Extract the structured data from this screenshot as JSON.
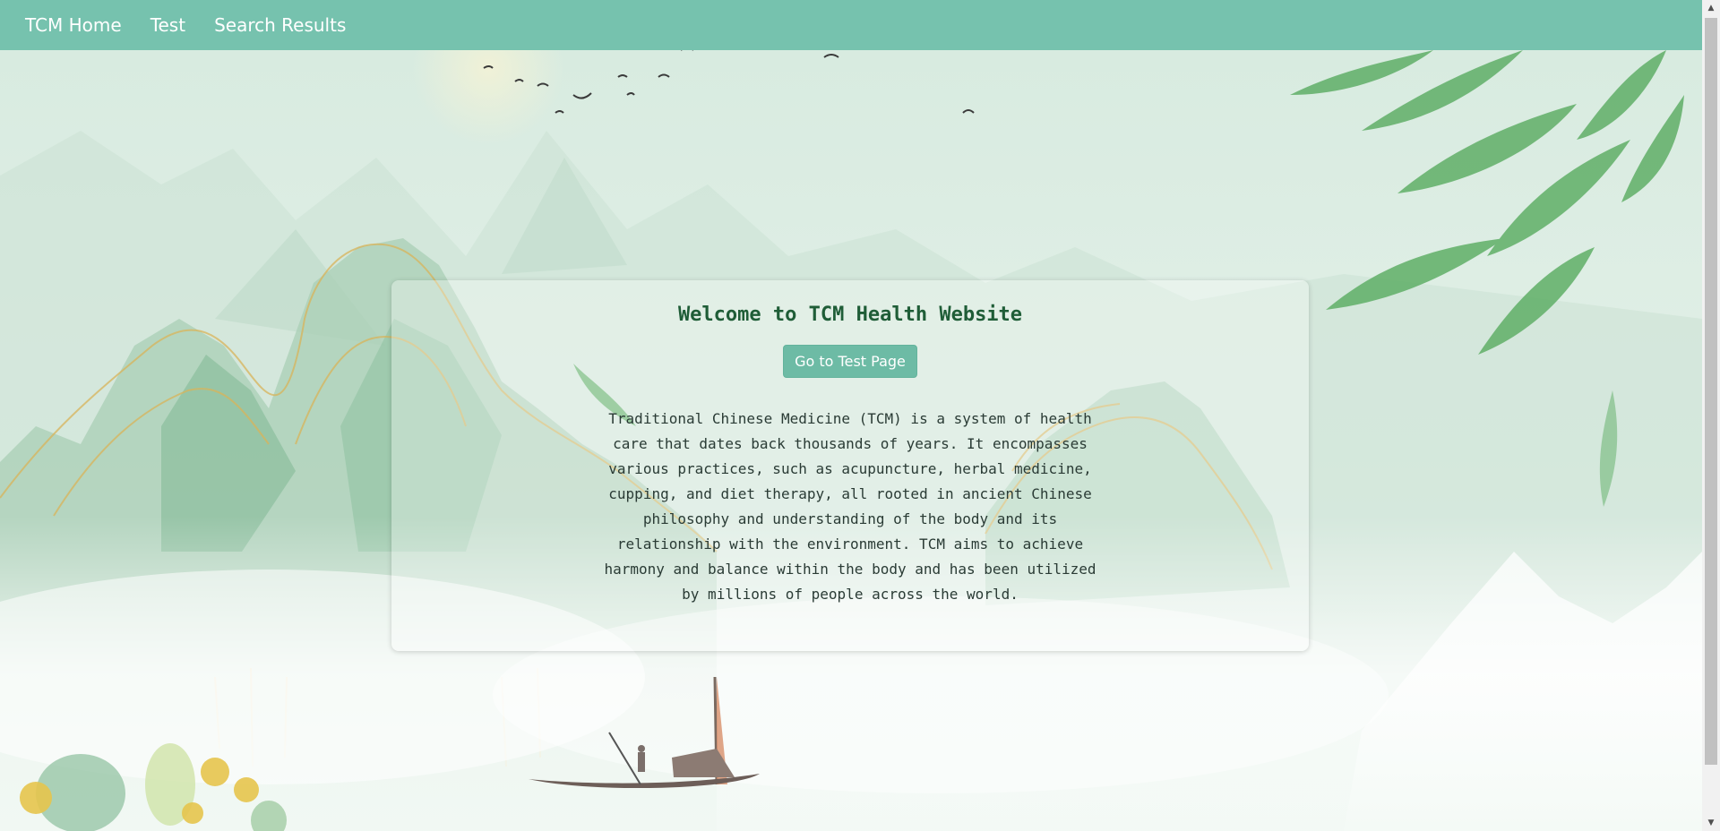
{
  "nav": {
    "links": [
      "TCM Home",
      "Test",
      "Search Results"
    ]
  },
  "hero": {
    "title": "Welcome to TCM Health Website",
    "button_label": "Go to Test Page",
    "description": "Traditional Chinese Medicine (TCM) is a system of health care that dates back thousands of years. It encompasses various practices, such as acupuncture, herbal medicine, cupping, and diet therapy, all rooted in ancient Chinese philosophy and understanding of the body and its relationship with the environment. TCM aims to achieve harmony and balance within the body and has been utilized by millions of people across the world."
  },
  "colors": {
    "navbar": "#76c2ae",
    "button": "#6dbba5",
    "title": "#1f5d37"
  }
}
